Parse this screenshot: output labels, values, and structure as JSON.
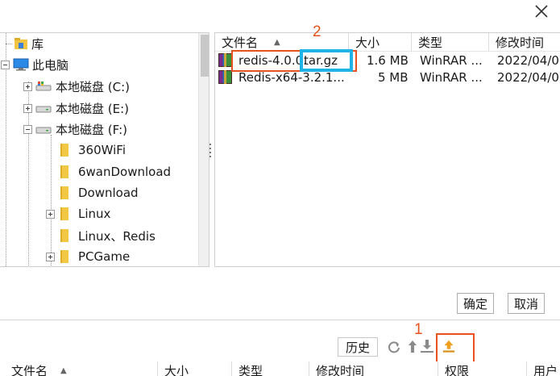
{
  "tree": {
    "items": [
      {
        "label": "库",
        "icon": "library-icon"
      },
      {
        "label": "此电脑",
        "icon": "computer-icon"
      },
      {
        "label": "本地磁盘 (C:)",
        "icon": "drive-icon"
      },
      {
        "label": "本地磁盘 (E:)",
        "icon": "drive-icon"
      },
      {
        "label": "本地磁盘 (F:)",
        "icon": "drive-icon"
      },
      {
        "label": "360WiFi",
        "icon": "folder-icon"
      },
      {
        "label": "6wanDownload",
        "icon": "folder-icon"
      },
      {
        "label": "Download",
        "icon": "folder-icon"
      },
      {
        "label": "Linux",
        "icon": "folder-icon"
      },
      {
        "label": "Linux、Redis",
        "icon": "folder-icon"
      },
      {
        "label": "PCGame",
        "icon": "folder-icon"
      }
    ]
  },
  "file_list": {
    "columns": [
      "文件名",
      "大小",
      "类型",
      "修改时间"
    ],
    "sort_arrow": "▲",
    "rows": [
      {
        "name_prefix": "redis-4.0.0.",
        "name_ext": "tar.gz",
        "size": "1.6 MB",
        "type": "WinRAR ...",
        "modified": "2022/04/0"
      },
      {
        "name_prefix": "Redis-x64-3.2.1...",
        "name_ext": "",
        "size": "5 MB",
        "type": "WinRAR ...",
        "modified": "2022/04/0"
      }
    ]
  },
  "dialog_buttons": {
    "ok": "确定",
    "cancel": "取消"
  },
  "toolbar": {
    "history": "历史"
  },
  "remote_list": {
    "columns": [
      "文件名",
      "大小",
      "类型",
      "修改时间",
      "权限",
      "用户"
    ]
  },
  "annotations": {
    "step1": "1",
    "step2": "2"
  },
  "colors": {
    "annotation_orange": "#e8531d",
    "annotation_blue": "#1fb3e8",
    "upload_icon": "#f0a020"
  }
}
